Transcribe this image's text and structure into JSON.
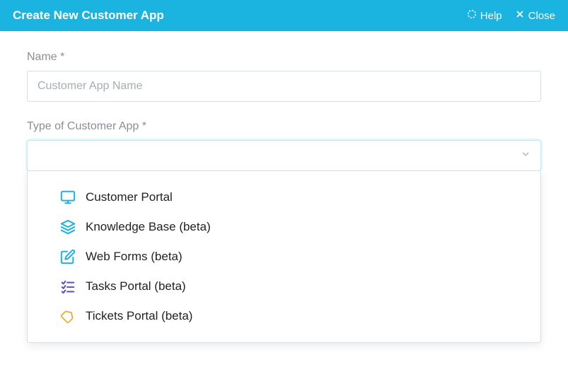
{
  "header": {
    "title": "Create New Customer App",
    "help_label": "Help",
    "close_label": "Close"
  },
  "form": {
    "name_label": "Name *",
    "name_placeholder": "Customer App Name",
    "type_label": "Type of Customer App *"
  },
  "type_options": [
    {
      "icon": "monitor-icon",
      "label": "Customer Portal",
      "color": "#1bb3e0"
    },
    {
      "icon": "layers-icon",
      "label": "Knowledge Base (beta)",
      "color": "#1bb3e0"
    },
    {
      "icon": "edit-icon",
      "label": "Web Forms (beta)",
      "color": "#1bb3e0"
    },
    {
      "icon": "tasks-icon",
      "label": "Tasks Portal (beta)",
      "color": "#5a4bdb"
    },
    {
      "icon": "ticket-icon",
      "label": "Tickets Portal (beta)",
      "color": "#f5a623"
    }
  ]
}
